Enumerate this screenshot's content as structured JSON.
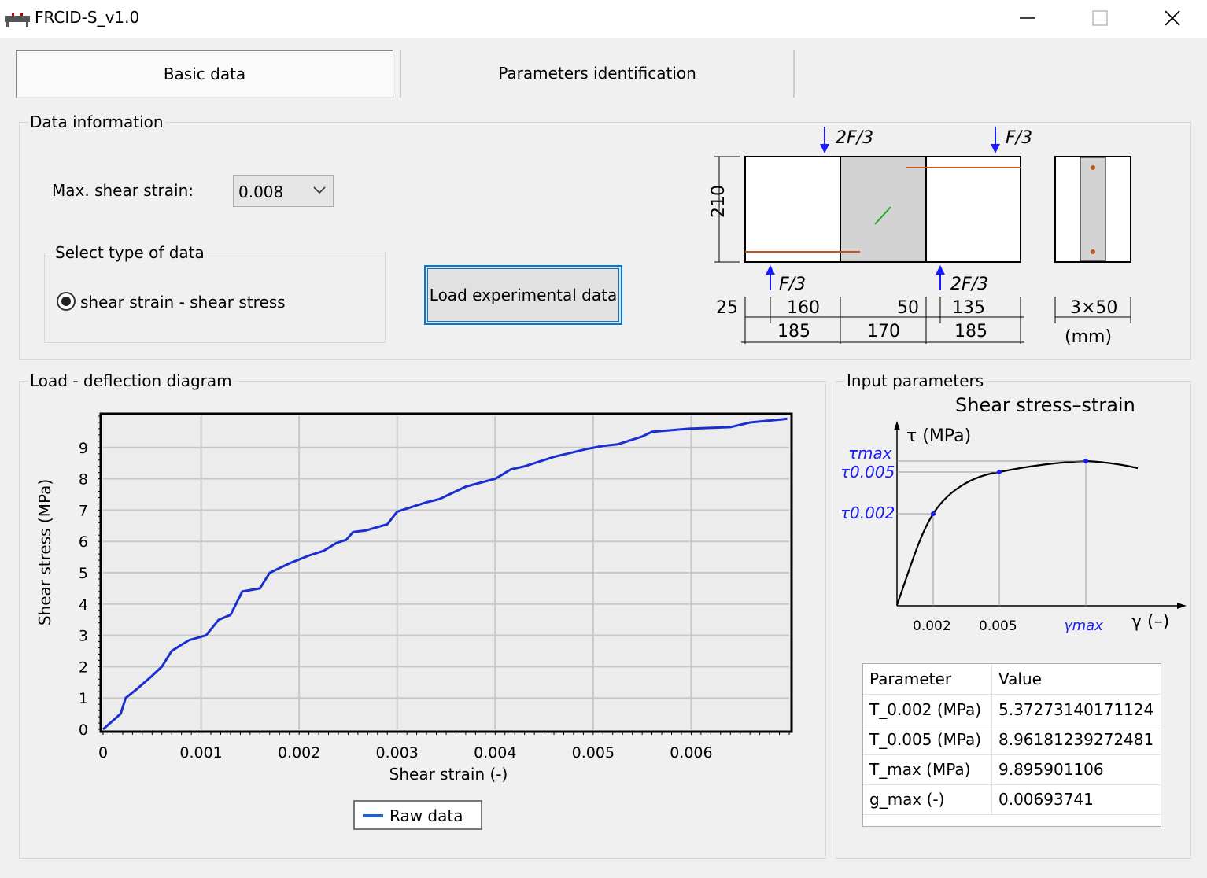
{
  "window": {
    "title": "FRCID-S_v1.0",
    "minimize_glyph": "—",
    "maximize_glyph": "☐",
    "close_glyph": "✕"
  },
  "tabs": [
    {
      "label": "Basic data",
      "selected": true
    },
    {
      "label": "Parameters identification",
      "selected": false
    }
  ],
  "data_information": {
    "legend": "Data information",
    "max_shear_strain_label": "Max. shear strain:",
    "max_shear_strain_value": "0.008",
    "select_type_legend": "Select type of data",
    "radio_label": "shear strain - shear stress",
    "radio_checked": true,
    "load_button_label": "Load experimental data"
  },
  "specimen": {
    "top_load_left": "2F/3",
    "top_load_right": "F/3",
    "bottom_load_left": "F/3",
    "bottom_load_right": "2F/3",
    "height": "210",
    "dims_row1": [
      "25",
      "160",
      "50",
      "135"
    ],
    "dims_row2": [
      "185",
      "170",
      "185"
    ],
    "section_dim": "3×50",
    "unit": "(mm)"
  },
  "chart_panel": {
    "legend": "Load - deflection diagram"
  },
  "chart_data": {
    "type": "line",
    "title": "",
    "xlabel": "Shear strain (-)",
    "ylabel": "Shear stress (MPa)",
    "xlim": [
      0,
      0.007
    ],
    "ylim": [
      0,
      10
    ],
    "x_ticks": [
      "0",
      "0.001",
      "0.002",
      "0.003",
      "0.004",
      "0.005",
      "0.006"
    ],
    "y_ticks": [
      "0",
      "1",
      "2",
      "3",
      "4",
      "5",
      "6",
      "7",
      "8",
      "9"
    ],
    "grid": true,
    "legend_position": "bottom-center",
    "series": [
      {
        "name": "Raw data",
        "color": "#1a2fd1",
        "x": [
          0,
          0.00018,
          0.00023,
          0.00035,
          0.00048,
          0.0006,
          0.0007,
          0.0008,
          0.00088,
          0.00105,
          0.00118,
          0.0013,
          0.00142,
          0.0016,
          0.0017,
          0.0019,
          0.0021,
          0.00225,
          0.00238,
          0.00248,
          0.00255,
          0.00268,
          0.0029,
          0.003,
          0.0033,
          0.00343,
          0.0037,
          0.004,
          0.00416,
          0.0043,
          0.0046,
          0.00493,
          0.0051,
          0.00525,
          0.00535,
          0.0055,
          0.0056,
          0.00598,
          0.0064,
          0.0066,
          0.00693,
          0.00698
        ],
        "y": [
          0,
          0.5,
          1.0,
          1.3,
          1.65,
          2.0,
          2.5,
          2.7,
          2.85,
          3.0,
          3.5,
          3.65,
          4.4,
          4.5,
          5.0,
          5.3,
          5.55,
          5.7,
          5.95,
          6.05,
          6.3,
          6.35,
          6.55,
          6.95,
          7.25,
          7.35,
          7.75,
          8.0,
          8.3,
          8.4,
          8.7,
          8.95,
          9.05,
          9.1,
          9.2,
          9.35,
          9.5,
          9.6,
          9.65,
          9.8,
          9.9,
          9.92
        ]
      }
    ]
  },
  "input_parameters": {
    "legend": "Input parameters",
    "schematic": {
      "title": "Shear stress–strain",
      "y_axis": "τ (MPa)",
      "x_axis": "γ (–)",
      "tau_max": "τmax",
      "tau_0005": "τ0.005",
      "tau_0002": "τ0.002",
      "x_tick_1": "0.002",
      "x_tick_2": "0.005",
      "x_tick_3": "γmax"
    },
    "table": {
      "headers": [
        "Parameter",
        "Value"
      ],
      "rows": [
        [
          "T_0.002 (MPa)",
          "5.37273140171124"
        ],
        [
          "T_0.005 (MPa)",
          "8.96181239272481"
        ],
        [
          "T_max (MPa)",
          "9.895901106"
        ],
        [
          "g_max (-)",
          "0.00693741"
        ]
      ]
    }
  },
  "colors": {
    "accent": "#0078d7",
    "series": "#1a2fd1",
    "rebar": "#c0561c",
    "schematic_blue": "#1a1aff"
  }
}
